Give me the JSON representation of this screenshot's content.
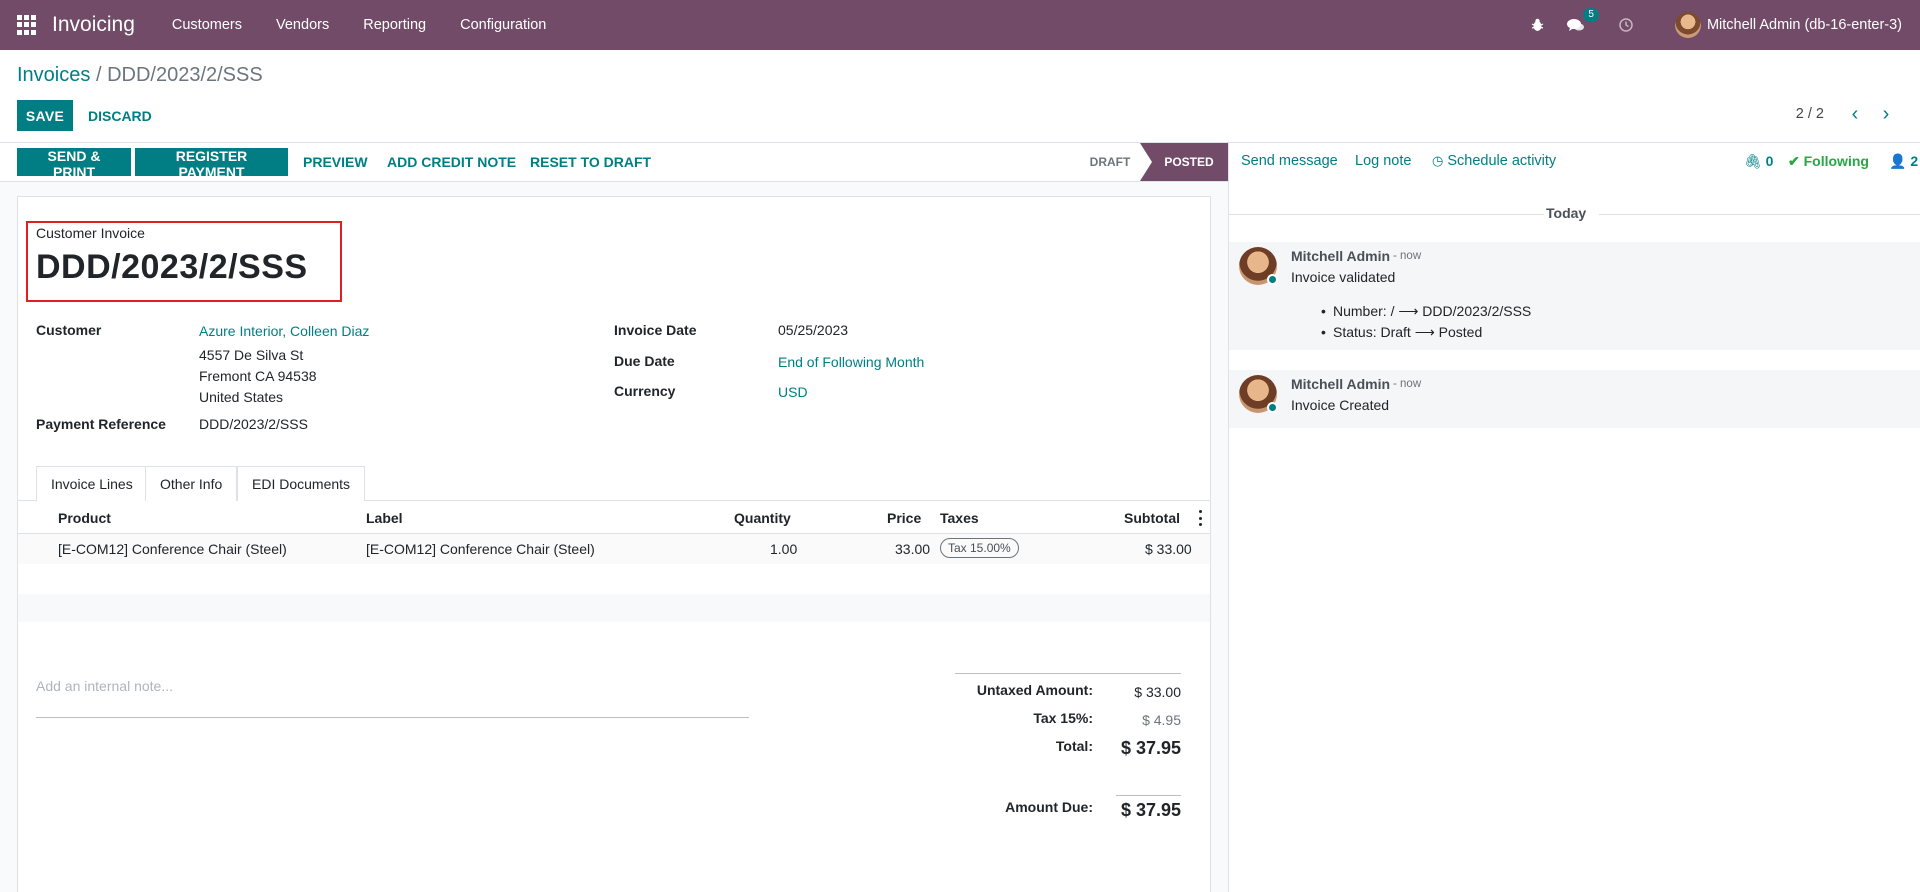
{
  "app": {
    "brand": "Invoicing",
    "menu": [
      "Customers",
      "Vendors",
      "Reporting",
      "Configuration"
    ]
  },
  "systray": {
    "messages_count": "5",
    "user": "Mitchell Admin (db-16-enter-3)",
    "icons": [
      "bug-icon",
      "chat-icon",
      "clock-icon"
    ]
  },
  "breadcrumb": {
    "parent": "Invoices",
    "separator": "/",
    "current": "DDD/2023/2/SSS"
  },
  "control": {
    "save": "SAVE",
    "discard": "DISCARD",
    "pager": "2 / 2"
  },
  "status_buttons": {
    "send_print": "SEND & PRINT",
    "register_payment": "REGISTER PAYMENT",
    "preview": "PREVIEW",
    "add_credit_note": "ADD CREDIT NOTE",
    "reset_to_draft": "RESET TO DRAFT"
  },
  "stages": {
    "draft": "DRAFT",
    "posted": "POSTED",
    "current": "posted"
  },
  "invoice": {
    "type_label": "Customer Invoice",
    "number": "DDD/2023/2/SSS",
    "customer_label": "Customer",
    "customer": "Azure Interior, Colleen Diaz",
    "address_line1": "4557 De Silva St",
    "address_line2": "Fremont CA 94538",
    "address_line3": "United States",
    "payment_reference_label": "Payment Reference",
    "payment_reference": "DDD/2023/2/SSS",
    "invoice_date_label": "Invoice Date",
    "invoice_date": "05/25/2023",
    "due_date_label": "Due Date",
    "due_date": "End of Following Month",
    "currency_label": "Currency",
    "currency": "USD"
  },
  "tabs": [
    {
      "label": "Invoice Lines",
      "active": true
    },
    {
      "label": "Other Info",
      "active": false
    },
    {
      "label": "EDI Documents",
      "active": false
    }
  ],
  "lines": {
    "columns": [
      "Product",
      "Label",
      "Quantity",
      "Price",
      "Taxes",
      "Subtotal"
    ],
    "rows": [
      {
        "product": "[E-COM12] Conference Chair (Steel)",
        "label": "[E-COM12] Conference Chair (Steel)",
        "quantity": "1.00",
        "price": "33.00",
        "taxes": "Tax 15.00%",
        "subtotal": "$ 33.00"
      }
    ]
  },
  "note": {
    "placeholder": "Add an internal note..."
  },
  "totals": {
    "untaxed_label": "Untaxed Amount:",
    "untaxed": "$ 33.00",
    "tax_label": "Tax 15%:",
    "tax": "$ 4.95",
    "total_label": "Total:",
    "total": "$ 37.95",
    "due_label": "Amount Due:",
    "due": "$ 37.95"
  },
  "chatter": {
    "send_message": "Send message",
    "log_note": "Log note",
    "schedule_activity": "Schedule activity",
    "attachments": "0",
    "following": "Following",
    "followers": "2",
    "date_separator": "Today",
    "messages": [
      {
        "author": "Mitchell Admin",
        "time": "- now",
        "body": "Invoice validated",
        "changes": [
          "Number: / ⟶ DDD/2023/2/SSS",
          "Status: Draft ⟶ Posted"
        ]
      },
      {
        "author": "Mitchell Admin",
        "time": "- now",
        "body": "Invoice Created",
        "changes": []
      }
    ]
  },
  "colors": {
    "brand": "#714b67",
    "accent": "#017e84",
    "following": "#28a745",
    "highlight_border": "#e02020"
  }
}
